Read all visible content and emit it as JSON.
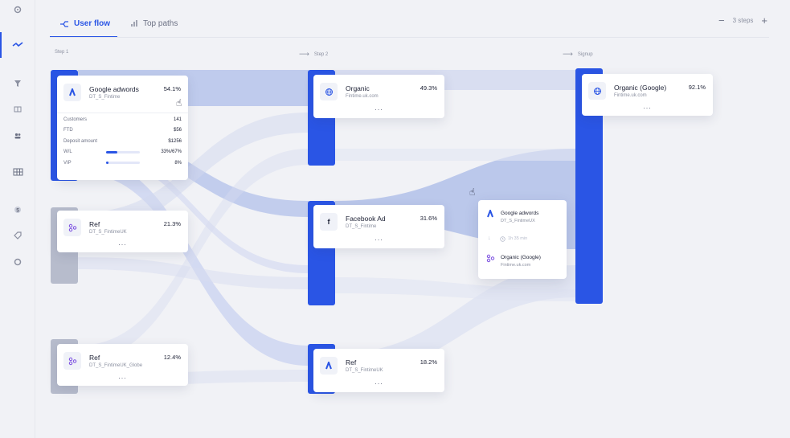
{
  "tabs": [
    {
      "label": "User flow",
      "icon": "flow-icon",
      "active": true
    },
    {
      "label": "Top paths",
      "icon": "bar-chart-icon",
      "active": false
    }
  ],
  "steps_control": {
    "minus": "−",
    "label": "3 steps",
    "plus": "+"
  },
  "step_labels": {
    "step1": "Step 1",
    "step2": "Step 2",
    "step3": "Signup"
  },
  "sidebar": {
    "icons": [
      "settings-icon",
      "flow-icon",
      "filter-icon",
      "table-icon",
      "users-icon",
      "grid-icon",
      "currency-icon",
      "tag-icon",
      "circle-icon"
    ]
  },
  "colors": {
    "accent": "#2a55e5",
    "flow": "#aebde9",
    "gray_bar": "#b7bccc"
  },
  "step1": [
    {
      "title": "Google adwords",
      "sub": "DT_S_Fintime",
      "pct": "54.1%",
      "icon": "google-ads-icon",
      "metrics": [
        {
          "label": "Customers",
          "value": "141"
        },
        {
          "label": "FTD",
          "value": "$56"
        },
        {
          "label": "Deposit amount",
          "value": "$1256"
        },
        {
          "label": "W/L",
          "value": "33%/67%",
          "bar": 0.33
        },
        {
          "label": "VIP",
          "value": "8%",
          "bar": 0.08
        }
      ]
    },
    {
      "title": "Ref",
      "sub": "DT_S_FintimeUK",
      "pct": "21.3%",
      "icon": "referral-icon",
      "dots": "..."
    },
    {
      "title": "Ref",
      "sub": "DT_S_FintimeUK_Globe",
      "pct": "12.4%",
      "icon": "referral-icon",
      "dots": "..."
    }
  ],
  "step2": [
    {
      "title": "Organic",
      "sub": "Fintime.uk.com",
      "pct": "49.3%",
      "icon": "globe-icon",
      "dots": "..."
    },
    {
      "title": "Facebook Ad",
      "sub": "DT_S_Fintime",
      "pct": "31.6%",
      "icon": "facebook-icon",
      "dots": "..."
    },
    {
      "title": "Ref",
      "sub": "DT_S_FintimeUK",
      "pct": "18.2%",
      "icon": "google-ads-icon",
      "dots": "..."
    }
  ],
  "step3": [
    {
      "title": "Organic (Google)",
      "sub": "Fintime.uk.com",
      "pct": "92.1%",
      "icon": "globe-icon",
      "dots": "..."
    }
  ],
  "tooltip": {
    "from_title": "Google adwords",
    "from_sub": "DT_S_FintimeUX",
    "duration": "1h 35 min",
    "to_title": "Organic (Google)",
    "to_sub": "Fintime.uk.com"
  }
}
